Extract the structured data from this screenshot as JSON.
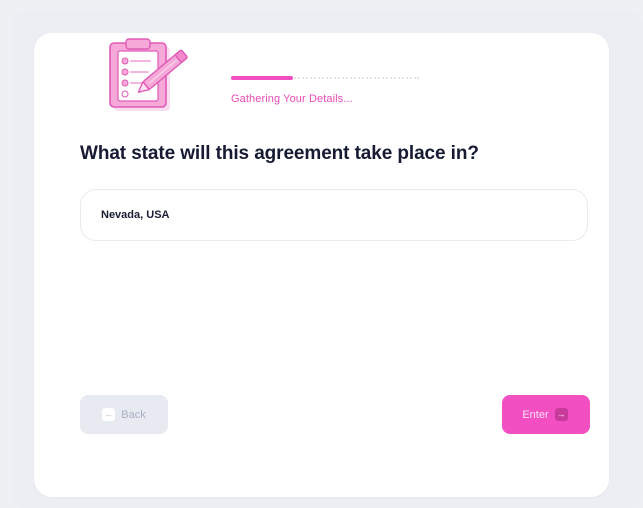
{
  "theme": {
    "accent": "#f24fc2",
    "progress_fill": "#f24fc2",
    "progress_label_color": "#e84bb8"
  },
  "header": {
    "illustration_icon": "clipboard-pencil-icon",
    "progress_label": "Gathering Your Details...",
    "progress_fraction": 0.33
  },
  "question": {
    "text": "What state will this agreement take place in?"
  },
  "answer": {
    "value": "Nevada, USA"
  },
  "nav": {
    "back_label": "Back",
    "back_icon": "arrow-left-icon",
    "enter_label": "Enter",
    "enter_icon": "arrow-right-icon"
  }
}
